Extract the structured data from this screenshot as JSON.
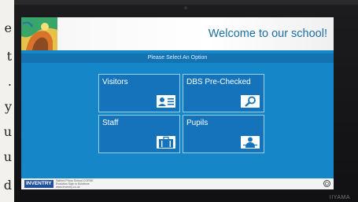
{
  "paper_strip": {
    "chars": [
      "e",
      "t",
      ".",
      "y",
      "u",
      "u",
      "d"
    ]
  },
  "header": {
    "title": "Welcome to our school!"
  },
  "select_prompt": "Please Select An Option",
  "tiles": [
    {
      "label": "Visitors",
      "icon": "id-card-icon"
    },
    {
      "label": "DBS Pre-Checked",
      "icon": "magnifier-icon"
    },
    {
      "label": "Staff",
      "icon": "briefcase-icon"
    },
    {
      "label": "Pupils",
      "icon": "child-icon"
    }
  ],
  "footer": {
    "brand": "INVENTRY",
    "lines": [
      "Salford Priory School CORSE",
      "Evolution Sign in Solutions",
      "www.inventry.co.uk"
    ]
  },
  "bezel_brand": "IIYAMA",
  "colors": {
    "screen": "#1587c9",
    "tile": "#1473bb",
    "title": "#1b6fa6"
  }
}
